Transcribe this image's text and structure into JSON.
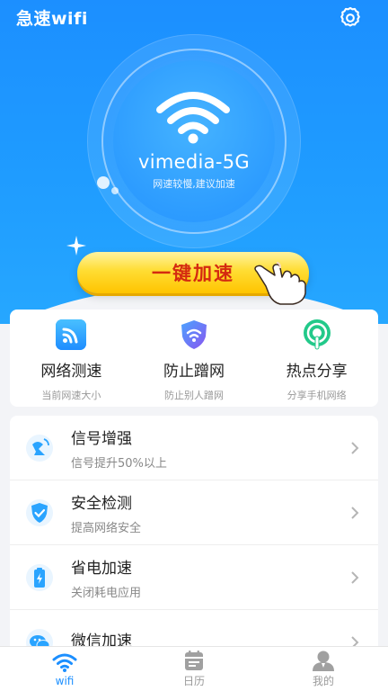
{
  "app": {
    "title": "急速wifi"
  },
  "wifi": {
    "ssid": "vimedia-5G",
    "status": "网速较慢,建议加速"
  },
  "boost": {
    "label": "一键加速"
  },
  "features": [
    {
      "title": "网络测速",
      "sub": "当前网速大小",
      "icon": "speedtest-wifi-icon",
      "color": "#2aa4ff"
    },
    {
      "title": "防止蹭网",
      "sub": "防止别人蹭网",
      "icon": "shield-wifi-icon",
      "color": "#6b6cf5"
    },
    {
      "title": "热点分享",
      "sub": "分享手机网络",
      "icon": "hotspot-icon",
      "color": "#22c98a"
    }
  ],
  "list": [
    {
      "title": "信号增强",
      "sub": "信号提升50%以上",
      "icon": "signal-antenna-icon",
      "color": "#2aa4ff"
    },
    {
      "title": "安全检测",
      "sub": "提高网络安全",
      "icon": "security-shield-icon",
      "color": "#2aa4ff"
    },
    {
      "title": "省电加速",
      "sub": "关闭耗电应用",
      "icon": "battery-icon",
      "color": "#2aa4ff"
    },
    {
      "title": "微信加速",
      "sub": "",
      "icon": "wechat-icon",
      "color": "#2aa4ff"
    }
  ],
  "tabs": [
    {
      "label": "wifi",
      "icon": "wifi-tab-icon",
      "active": true
    },
    {
      "label": "日历",
      "icon": "calendar-icon",
      "active": false
    },
    {
      "label": "我的",
      "icon": "profile-icon",
      "active": false
    }
  ],
  "colors": {
    "accent": "#1c8fff",
    "tab_active": "#1c8fff",
    "tab_inactive": "#9a9a9a",
    "boost_text": "#d42a10"
  }
}
